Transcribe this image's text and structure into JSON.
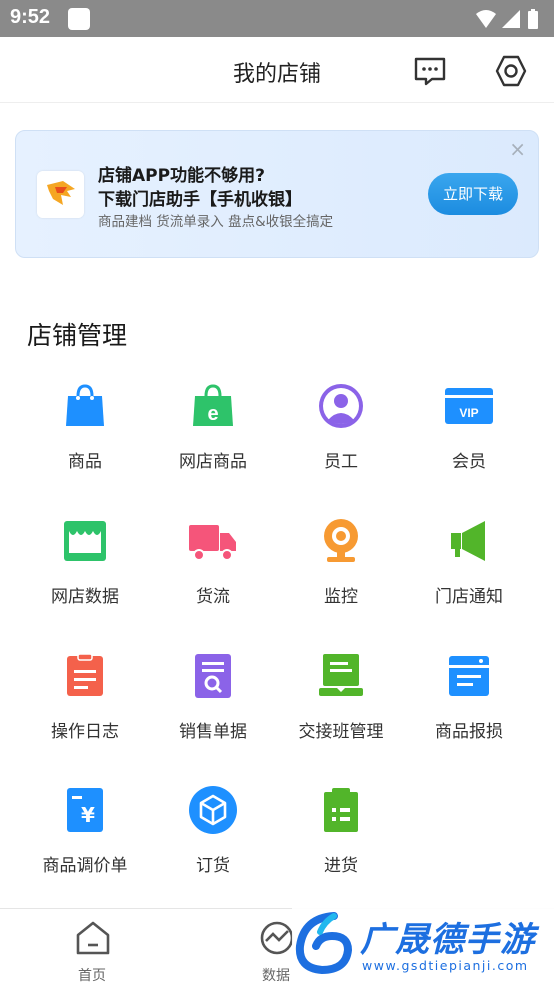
{
  "status_bar": {
    "time": "9:52"
  },
  "header": {
    "title": "我的店铺",
    "message_icon": "message-icon",
    "settings_icon": "settings-icon"
  },
  "banner": {
    "title_line1": "店铺APP功能不够用?",
    "title_line2": "下载门店助手【手机收银】",
    "subtitle": "商品建档 货流单录入 盘点&收银全搞定",
    "button_label": "立即下载",
    "close_label": "×"
  },
  "section": {
    "title": "店铺管理"
  },
  "grid": [
    {
      "label": "商品",
      "icon": "shopping-bag-icon",
      "color": "#1e90ff"
    },
    {
      "label": "网店商品",
      "icon": "e-bag-icon",
      "color": "#2ec36a"
    },
    {
      "label": "员工",
      "icon": "person-icon",
      "color": "#8b63e8"
    },
    {
      "label": "会员",
      "icon": "vip-card-icon",
      "color": "#1e90ff"
    },
    {
      "label": "网店数据",
      "icon": "store-icon",
      "color": "#2ec36a"
    },
    {
      "label": "货流",
      "icon": "truck-icon",
      "color": "#f5557a"
    },
    {
      "label": "监控",
      "icon": "camera-icon",
      "color": "#f79a32"
    },
    {
      "label": "门店通知",
      "icon": "megaphone-icon",
      "color": "#52b52a"
    },
    {
      "label": "操作日志",
      "icon": "log-icon",
      "color": "#f4614b"
    },
    {
      "label": "销售单据",
      "icon": "receipt-search-icon",
      "color": "#8b63e8"
    },
    {
      "label": "交接班管理",
      "icon": "handover-icon",
      "color": "#52b52a"
    },
    {
      "label": "商品报损",
      "icon": "calendar-doc-icon",
      "color": "#1e90ff"
    },
    {
      "label": "商品调价单",
      "icon": "price-doc-icon",
      "color": "#1e90ff"
    },
    {
      "label": "订货",
      "icon": "box-icon",
      "color": "#1e90ff"
    },
    {
      "label": "进货",
      "icon": "clipboard-icon",
      "color": "#52b52a"
    }
  ],
  "bottom_nav": [
    {
      "label": "首页",
      "icon": "home-icon"
    },
    {
      "label": "数据",
      "icon": "chart-icon"
    }
  ],
  "watermark": {
    "text": "广晟德手游",
    "url": "www.gsdtiepianji.com"
  }
}
